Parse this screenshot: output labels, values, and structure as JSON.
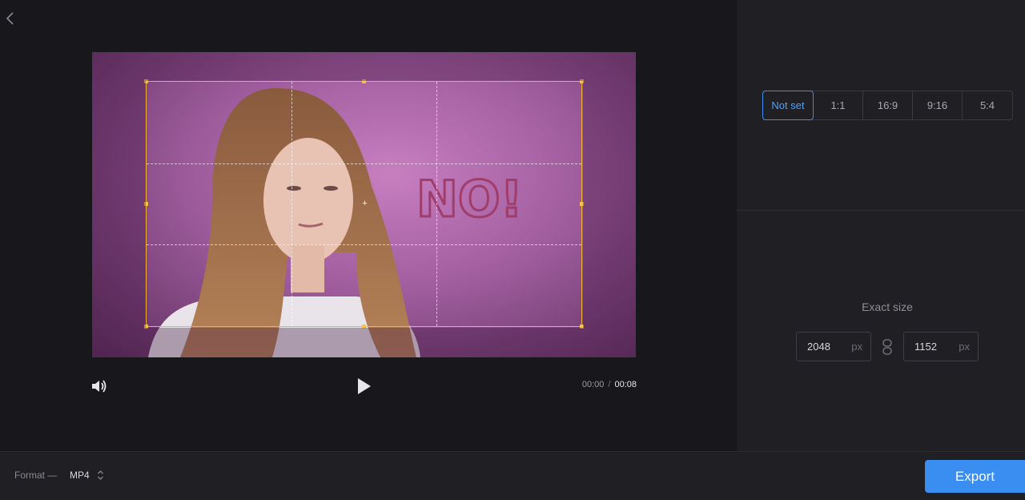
{
  "player": {
    "current_time": "00:00",
    "separator": "/",
    "duration": "00:08"
  },
  "video": {
    "overlay_text": "NO!"
  },
  "aspect_ratio": {
    "options": [
      "Not set",
      "1:1",
      "16:9",
      "9:16",
      "5:4"
    ],
    "selected": "Not set"
  },
  "exact_size": {
    "label": "Exact size",
    "width": "2048",
    "height": "1152",
    "unit": "px"
  },
  "footer": {
    "format_label": "Format —",
    "format_value": "MP4",
    "export_label": "Export"
  },
  "colors": {
    "accent": "#3a8df1",
    "crop_border": "#f2b233"
  },
  "icons": {
    "back": "chevron-left-icon",
    "volume": "volume-icon",
    "play": "play-icon",
    "link": "link-icon",
    "format_arrows": "up-down-arrows-icon"
  }
}
